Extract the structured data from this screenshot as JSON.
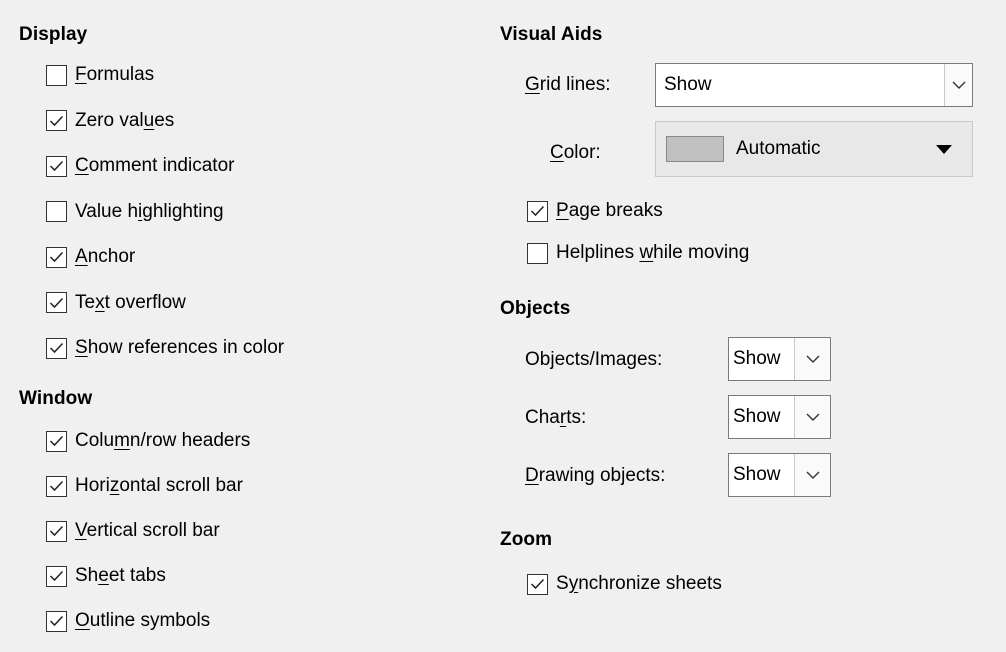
{
  "display": {
    "heading": "Display",
    "items": [
      {
        "pre": "",
        "u": "F",
        "post": "ormulas",
        "checked": false
      },
      {
        "pre": "Zero val",
        "u": "u",
        "post": "es",
        "checked": true
      },
      {
        "pre": "",
        "u": "C",
        "post": "omment indicator",
        "checked": true
      },
      {
        "pre": "Value h",
        "u": "i",
        "post": "ghlighting",
        "checked": false
      },
      {
        "pre": "",
        "u": "A",
        "post": "nchor",
        "checked": true
      },
      {
        "pre": "Te",
        "u": "x",
        "post": "t overflow",
        "checked": true
      },
      {
        "pre": "",
        "u": "S",
        "post": "how references in color",
        "checked": true
      }
    ]
  },
  "window": {
    "heading": "Window",
    "items": [
      {
        "pre": "Colu",
        "u": "m",
        "post": "n/row headers",
        "checked": true
      },
      {
        "pre": "Hori",
        "u": "z",
        "post": "ontal scroll bar",
        "checked": true
      },
      {
        "pre": "",
        "u": "V",
        "post": "ertical scroll bar",
        "checked": true
      },
      {
        "pre": "Sh",
        "u": "e",
        "post": "et tabs",
        "checked": true
      },
      {
        "pre": "",
        "u": "O",
        "post": "utline symbols",
        "checked": true
      }
    ]
  },
  "visual_aids": {
    "heading": "Visual Aids",
    "grid_lines": {
      "label_pre": "",
      "label_u": "G",
      "label_post": "rid lines:",
      "value": "Show"
    },
    "color": {
      "label_pre": "",
      "label_u": "C",
      "label_post": "olor:",
      "value": "Automatic",
      "swatch": "#c0c0c0"
    },
    "page_breaks": {
      "pre": "",
      "u": "P",
      "post": "age breaks",
      "checked": true
    },
    "helplines": {
      "pre": "Helplines ",
      "u": "w",
      "post": "hile moving",
      "checked": false
    }
  },
  "objects": {
    "heading": "Objects",
    "rows": [
      {
        "label_pre": "Ob",
        "label_u": "j",
        "label_post": "ects/Images:",
        "value": "Show"
      },
      {
        "label_pre": "Cha",
        "label_u": "r",
        "label_post": "ts:",
        "value": "Show"
      },
      {
        "label_pre": "",
        "label_u": "D",
        "label_post": "rawing objects:",
        "value": "Show"
      }
    ]
  },
  "zoom": {
    "heading": "Zoom",
    "sync": {
      "pre": "S",
      "u": "y",
      "post": "nchronize sheets",
      "checked": true
    }
  }
}
